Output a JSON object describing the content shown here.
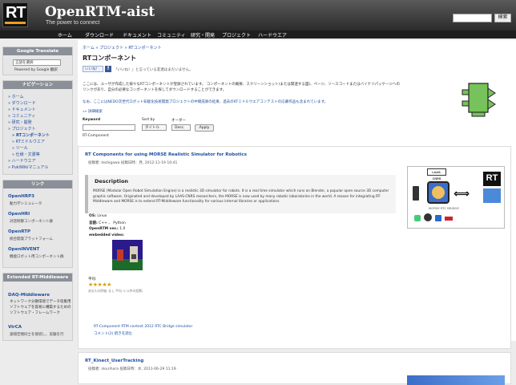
{
  "header": {
    "title": "OpenRTM-aist",
    "slogan": "The power to connect",
    "logo_text": "RT",
    "search_button": "検索"
  },
  "nav": [
    "ホーム",
    "ダウンロード",
    "ドキュメント",
    "コミュニティ",
    "研究・開発",
    "プロジェクト",
    "ハードウエア"
  ],
  "sidebar": {
    "translate_head": "Google Translate",
    "translate_select": "言語を選択",
    "translate_powered": "Powered by Google 翻訳",
    "nav_head": "ナビゲーション",
    "menu": [
      "» ホーム",
      "» ダウンロード",
      "» ドキュメント",
      "» コミュニティ",
      "» 研究・開発",
      "» プロジェクト",
      "» RTコンポーネント",
      "» RTミドルウエア",
      "» ツール",
      "» 仕様・文書等",
      "» ハードウエア",
      "» PukiWikiマニュアル"
    ],
    "links_head": "リンク",
    "links": [
      {
        "title": "OpenHRP3",
        "sub": "動力学シミュレータ"
      },
      {
        "title": "OpenHRI",
        "sub": "対話制御コンポーネント群"
      },
      {
        "title": "OpenRTP",
        "sub": "統合開発プラットフォーム"
      },
      {
        "title": "OpenINVENT",
        "sub": "機能ロボット用コンポーネント群"
      }
    ],
    "ext_head": "Extended RT-Middleware",
    "ext": [
      {
        "title": "DAQ-Middleware",
        "sub": "ネットワーク分散環境でデータ収集用ソフトウェアを容易に構築するためのソフトウェア・フレームワーク"
      },
      {
        "title": "VirCA",
        "sub": "遠隔空間同士を接続し、実験を行"
      }
    ]
  },
  "main": {
    "breadcrumb": "ホーム » プロジェクト » RTコンポーネント",
    "page_title": "RTコンポーネント",
    "like_label": "いいね！",
    "like_text": "「いいね！」と言っている友達はまだいません。",
    "intro": "ここには、ユーザが作成した様々なRTコンポーネントが登録されています。 コンポーネントの概要、スクリーンショット(または関連する図)、ページ、ソースコードまたはバイナリパッケージへのリンクがあり、自分の必要なコンポーネントを探してダウンロードすることができます。",
    "note": "なお、ここにはNEDO次世代ロボット知能化技術開発プロジェクトの中間成果の結果、過去のRTミドルウエアコンテストの応募作品も含まれています。",
    "detail_link": "»» 詳細検索",
    "filter": {
      "keyword_label": "Keyword",
      "sortby_label": "Sort by",
      "order_label": "オーダー",
      "sort_value": "タイトル",
      "order_value": "Desc.",
      "apply": "Apply"
    },
    "tag": "RT-Component",
    "posts": [
      {
        "title": "RT Components for using MORSE Realistic Simulator for Robotics",
        "meta": "投稿者: teshigawa 投稿日時：月, 2012-11-19 10:41",
        "section": "Description",
        "desc": "MORSE (Modular Open Robot Simulation Engine) is a realistic 3D simulator for robots. It is a real time simulator which runs on Blender, a popular open source 3D computer graphic software. Originated and developed by LAAS-CNRS researchers, the MORSE is now used by many robotic laboratories in the world. A reason for integrating RT-Middleware and MORSE is to extend RT-Middleware functionality for various internal libraries or applications.",
        "os_label": "OS:",
        "os": "Linux",
        "lang_label": "言語:",
        "lang": "C++ 、 Python",
        "rtm_label": "OpenRTM ver.:",
        "rtm": "1.0",
        "video_label": "embedded video:",
        "rating_label": "平均:",
        "stars": 5,
        "rating_sub": "あなたの評価: なし 平均: 5 (2件の投票)",
        "laas": "LAAS-CNRS",
        "figure_caption": "MORSE RTC BRIDGE",
        "tags": "RT-Component  RTM contest 2012  RTC Bridge  simulator",
        "comments": "コメント(2)  続きを読む"
      },
      {
        "title": "RT_Kinect_UserTracking",
        "meta": "投稿者: nkurihara 投稿日時：水, 2011-06-29 11:19"
      }
    ]
  },
  "colors": {
    "header": "#3a3a3a",
    "sidebar_head": "#8a8f98",
    "link": "#1f4fa0",
    "component_green": "#77c25a"
  }
}
